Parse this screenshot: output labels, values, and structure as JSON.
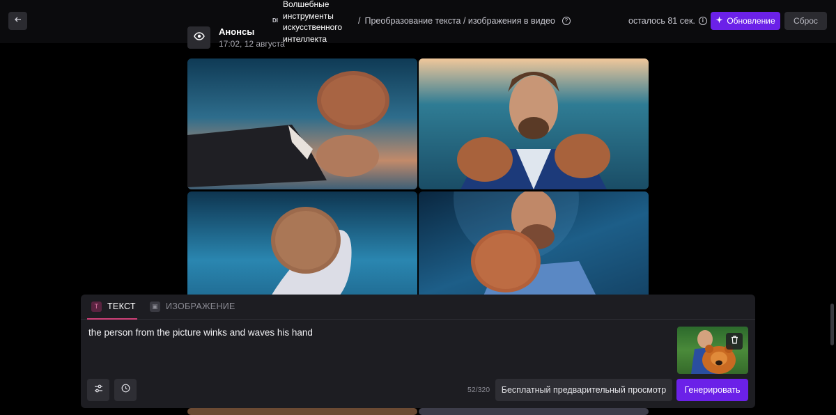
{
  "topbar": {
    "back_icon": "arrow-left-icon",
    "logo_mark": "DI",
    "app_title": "Волшебные инструменты искусственного интеллекта",
    "breadcrumb_sep": "/",
    "breadcrumb_page": "Преобразование текста / изображения в видео",
    "help_icon": "question-circle-icon",
    "timer_text": "осталось 81 сек.",
    "info_icon": "info-circle-icon",
    "upgrade_label": "Обновление",
    "upgrade_icon": "sparkle-icon",
    "reset_label": "Сброс"
  },
  "announcement": {
    "icon": "eye-icon",
    "title": "Анонсы",
    "time": "17:02, 12 августа"
  },
  "gallery": {
    "images": [
      {
        "icon": "image-hand-holding-fuzzy-object"
      },
      {
        "icon": "image-man-holding-fuzzy-objects"
      },
      {
        "icon": "image-fuzzy-object-in-hand"
      },
      {
        "icon": "image-bearded-man-holding-fuzzy-object"
      }
    ]
  },
  "prompt_panel": {
    "tabs": [
      {
        "label": "ТЕКСТ",
        "icon": "text-icon",
        "glyph": "T",
        "active": true
      },
      {
        "label": "ИЗОБРАЖЕНИЕ",
        "icon": "image-icon",
        "glyph": "▣",
        "active": false
      }
    ],
    "prompt": "the person from the picture winks and waves his hand",
    "char_counter": "52/320",
    "preview_label": "Бесплатный предварительный просмотр",
    "generate_label": "Генерировать",
    "settings_icon": "sliders-icon",
    "history_icon": "clock-icon",
    "trash_icon": "trash-icon",
    "thumbnail_icon": "image-man-with-bear-thumbnail"
  },
  "colors": {
    "accent": "#6b21e8",
    "tab_underline": "#d1417a",
    "panel_bg": "#1d1d22",
    "button_bg": "#2e2e34"
  }
}
